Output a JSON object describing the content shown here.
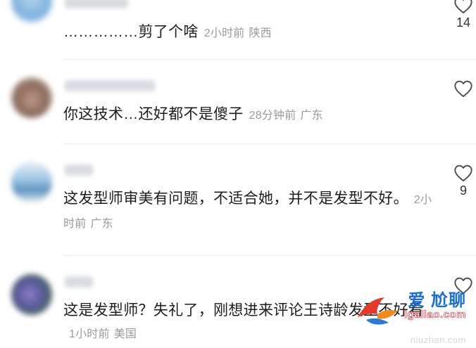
{
  "comments": [
    {
      "text": "……………剪了个啥",
      "time": "2小时前",
      "location": "陕西",
      "likes": "14"
    },
    {
      "text": "你这技术…还好都不是傻子",
      "time": "28分钟前",
      "location": "广东",
      "likes": ""
    },
    {
      "text": "这发型师审美有问题，不适合她，并不是发型不好。",
      "time": "2小时前",
      "location": "广东",
      "likes": "9"
    },
    {
      "text": "这是发型师？失礼了，刚想进来评论王诗龄发型不好看",
      "time": "1小时前",
      "location": "美国",
      "likes": ""
    }
  ],
  "watermark": {
    "title": "爱 尬聊",
    "site": "igaliao.com",
    "sub": "niuzhan.com"
  },
  "icons": {
    "like": "heart-outline-icon"
  },
  "colors": {
    "meta_text": "#9a9a9a",
    "body_text": "#1c1c1c",
    "divider": "#ececec",
    "watermark_blue": "#1b6fd1",
    "watermark_red": "#d3182a"
  }
}
